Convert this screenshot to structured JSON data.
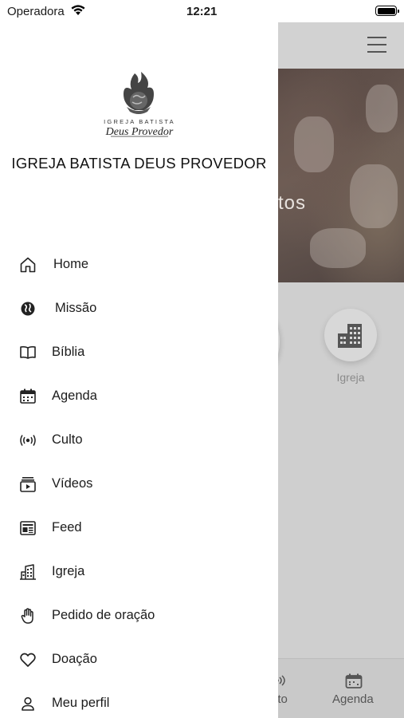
{
  "status_bar": {
    "carrier": "Operadora",
    "time": "12:21"
  },
  "drawer": {
    "church_name": "IGREJA BATISTA DEUS PROVEDOR",
    "logo": {
      "text_line1": "IGREJA BATISTA",
      "text_line2": "Deus Provedor"
    },
    "items": [
      {
        "label": "Home",
        "icon": "home-icon"
      },
      {
        "label": "Missão",
        "icon": "globe-icon"
      },
      {
        "label": "Bíblia",
        "icon": "book-icon"
      },
      {
        "label": "Agenda",
        "icon": "calendar-icon"
      },
      {
        "label": "Culto",
        "icon": "broadcast-icon"
      },
      {
        "label": "Vídeos",
        "icon": "video-icon"
      },
      {
        "label": "Feed",
        "icon": "newspaper-icon"
      },
      {
        "label": "Igreja",
        "icon": "building-icon"
      },
      {
        "label": "Pedido de oração",
        "icon": "hand-icon"
      },
      {
        "label": "Doação",
        "icon": "heart-icon"
      },
      {
        "label": "Meu perfil",
        "icon": "user-icon"
      }
    ]
  },
  "background_app": {
    "banner_text_partial": "tos",
    "shortcut_label": "Igreja",
    "tabbar": {
      "culto_partial": "lto",
      "agenda": "Agenda"
    }
  }
}
